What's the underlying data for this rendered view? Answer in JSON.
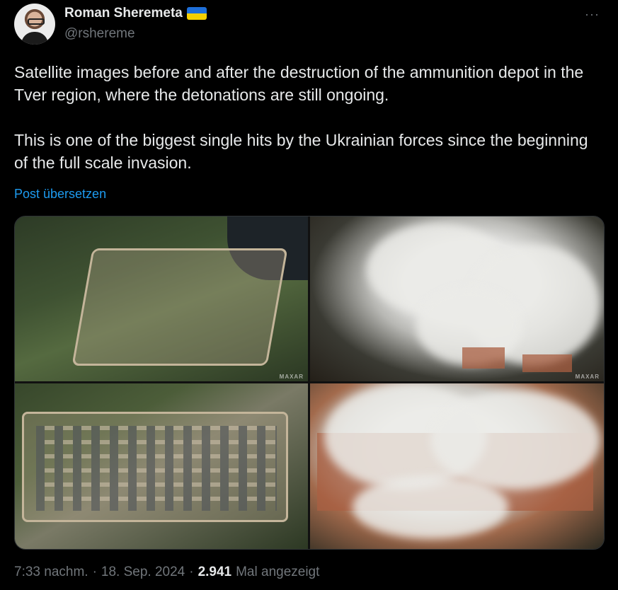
{
  "author": {
    "name": "Roman Sheremeta",
    "handle": "@rshereme",
    "badge_icon": "ukraine-flag-icon",
    "flag_colors": [
      "#1e6fd9",
      "#f5d000"
    ]
  },
  "more_label": "···",
  "post": {
    "paragraph1": "Satellite images before and after the destruction of the ammunition depot in the Tver region, where the detonations are still ongoing.",
    "paragraph2": "This is one of the biggest single hits by the Ukrainian forces since the beginning of the full scale invasion.",
    "translate_link": "Post übersetzen"
  },
  "media": {
    "watermark": "MAXAR"
  },
  "meta": {
    "time": "7:33 nachm.",
    "separator": "·",
    "date": "18. Sep. 2024",
    "views_count": "2.941",
    "views_label": "Mal angezeigt"
  },
  "colors": {
    "background": "#000000",
    "text": "#e7e9ea",
    "muted": "#71767b",
    "link": "#1d9bf0"
  }
}
